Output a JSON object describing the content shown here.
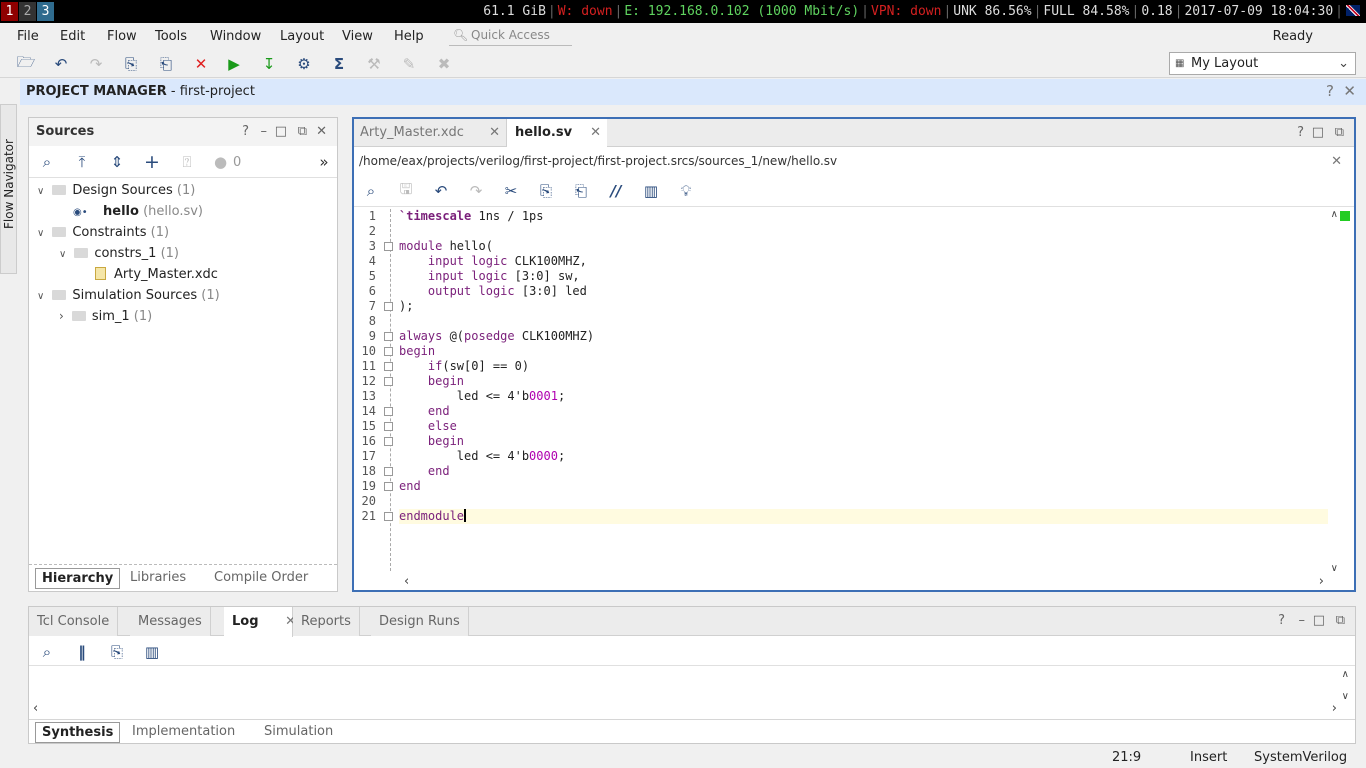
{
  "topbar": {
    "workspaces": [
      "1",
      "2",
      "3"
    ],
    "mem": "61.1 GiB",
    "wifi": "W: down",
    "eth": "E: 192.168.0.102 (1000 Mbit/s)",
    "vpn": "VPN: down",
    "unk": "UNK 86.56%",
    "full": "FULL 84.58%",
    "load": "0.18",
    "datetime": "2017-07-09 18:04:30"
  },
  "menu": {
    "items": [
      "File",
      "Edit",
      "Flow",
      "Tools",
      "Window",
      "Layout",
      "View",
      "Help"
    ],
    "quick_access": "Quick Access",
    "status": "Ready"
  },
  "layout_selector": "My Layout",
  "project_bar": {
    "title": "PROJECT MANAGER",
    "project": " - first-project"
  },
  "flow_navigator": "Flow Navigator",
  "sources": {
    "title": "Sources",
    "badge_count": "0",
    "tree": [
      {
        "label": "Design Sources",
        "count": "(1)"
      },
      {
        "label": "hello",
        "file": "(hello.sv)"
      },
      {
        "label": "Constraints",
        "count": "(1)"
      },
      {
        "label": "constrs_1",
        "count": "(1)"
      },
      {
        "label": "Arty_Master.xdc"
      },
      {
        "label": "Simulation Sources",
        "count": "(1)"
      },
      {
        "label": "sim_1",
        "count": "(1)"
      }
    ],
    "tabs": [
      "Hierarchy",
      "Libraries",
      "Compile Order"
    ]
  },
  "editor": {
    "tabs": [
      "Arty_Master.xdc",
      "hello.sv"
    ],
    "path": "/home/eax/projects/verilog/first-project/first-project.srcs/sources_1/new/hello.sv",
    "lines": [
      "1",
      "2",
      "3",
      "4",
      "5",
      "6",
      "7",
      "8",
      "9",
      "10",
      "11",
      "12",
      "13",
      "14",
      "15",
      "16",
      "17",
      "18",
      "19",
      "20",
      "21"
    ]
  },
  "bottom": {
    "tabs": [
      "Tcl Console",
      "Messages",
      "Log",
      "Reports",
      "Design Runs"
    ],
    "subtabs": [
      "Synthesis",
      "Implementation",
      "Simulation"
    ]
  },
  "statusbar": {
    "position": "21:9",
    "mode": "Insert",
    "language": "SystemVerilog"
  },
  "colors": {
    "project_bar": "#dae8fc",
    "accent_border": "#3d6fb5",
    "current_line": "#fffbe0",
    "workspace_active": "#2f6b8e",
    "workspace_urgent": "#8f0000"
  }
}
